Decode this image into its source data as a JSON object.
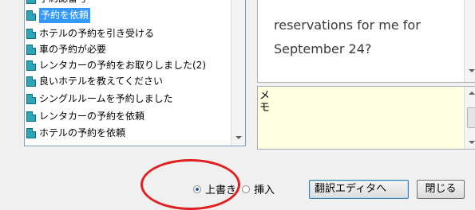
{
  "list": {
    "items": [
      {
        "label": "予約認番号",
        "selected": false
      },
      {
        "label": "予約を依頼",
        "selected": true
      },
      {
        "label": "ホテルの予約を引き受ける",
        "selected": false
      },
      {
        "label": "車の予約が必要",
        "selected": false
      },
      {
        "label": "レンタカーの予約をお取りしました(2)",
        "selected": false
      },
      {
        "label": "良いホテルを教えてください",
        "selected": false
      },
      {
        "label": "シングルルームを予約しました",
        "selected": false
      },
      {
        "label": "レンタカーの予約を依頼",
        "selected": false
      },
      {
        "label": "ホテルの予約を依頼",
        "selected": false
      }
    ]
  },
  "translation": {
    "text": "reservations for me for September 24?"
  },
  "memo": {
    "label": "メモ"
  },
  "controls": {
    "overwrite_label": "上書き",
    "insert_label": "挿入",
    "editor_button": "翻訳エディタへ",
    "close_button": "閉じる"
  },
  "colors": {
    "selection": "#3399ff",
    "memo_background": "#ffffe1",
    "annotation": "#e02020"
  }
}
